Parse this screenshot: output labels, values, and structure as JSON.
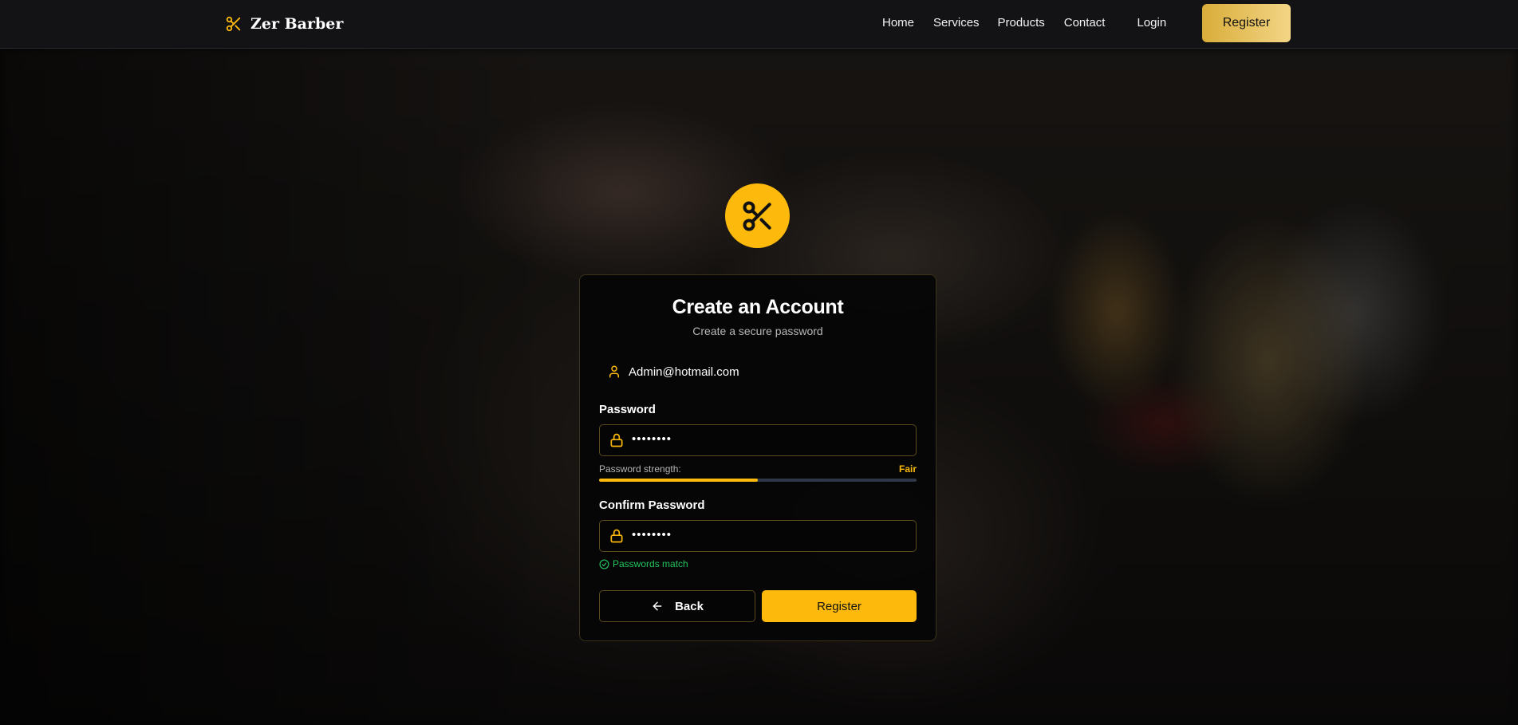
{
  "brand": {
    "name": "Zer Barber",
    "icon": "scissors-icon",
    "accent_color": "#fdba0c"
  },
  "nav": {
    "links": [
      "Home",
      "Services",
      "Products",
      "Contact"
    ],
    "login": "Login",
    "register": "Register"
  },
  "form": {
    "title": "Create an Account",
    "subtitle": "Create a secure password",
    "email": "Admin@hotmail.com",
    "password_label": "Password",
    "password_value": "••••••••",
    "strength_label": "Password strength:",
    "strength_value": "Fair",
    "strength_level": 0.5,
    "confirm_label": "Confirm Password",
    "confirm_value": "••••••••",
    "match_text": "Passwords match",
    "match_color": "#22c55e",
    "back_label": "Back",
    "register_label": "Register"
  }
}
